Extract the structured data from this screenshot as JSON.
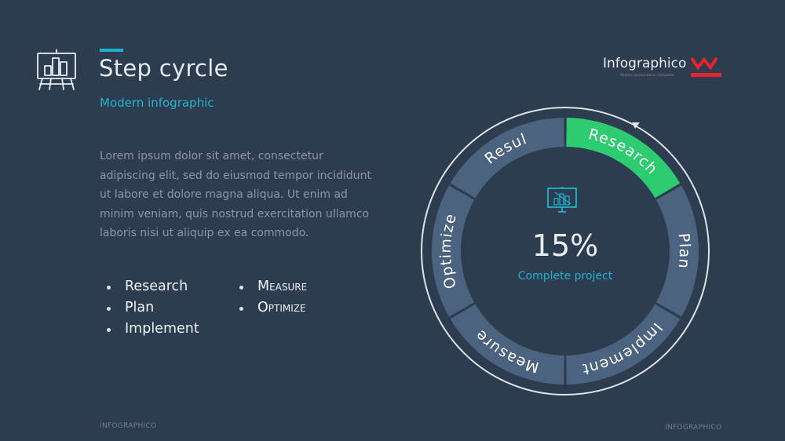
{
  "header": {
    "title": "Step cyrcle",
    "subtitle": "Modern infographic"
  },
  "description": "Lorem ipsum dolor sit amet, consectetur adipiscing elit, sed do eiusmod tempor incididunt ut labore et dolore magna aliqua. Ut enim ad minim veniam, quis nostrud exercitation ullamco laboris nisi ut aliquip ex ea commodo.",
  "bullets": {
    "column1": [
      "Research",
      "Plan",
      "Implement"
    ],
    "column2": [
      "Measure",
      "Optimize"
    ]
  },
  "logo": {
    "name": "Infographico",
    "tagline": "Modern presentation template"
  },
  "cycle": {
    "segments": [
      {
        "label": "Research",
        "active": true
      },
      {
        "label": "Plan",
        "active": false
      },
      {
        "label": "Implement",
        "active": false
      },
      {
        "label": "Measure",
        "active": false
      },
      {
        "label": "Optimize",
        "active": false
      },
      {
        "label": "Resul",
        "active": false
      }
    ],
    "progress": 15,
    "progress_label": "15%",
    "center_caption": "Complete project",
    "center_icon": "presentation-chart-icon"
  },
  "footer": {
    "left": "INFOGRAPHICO",
    "right": "INFOGRAPHICO"
  },
  "colors": {
    "background": "#2e3c4f",
    "accent": "#1fb3cf",
    "active_segment": "#2ecc71",
    "segment": "#4c6380",
    "brand_red": "#e8232b"
  }
}
